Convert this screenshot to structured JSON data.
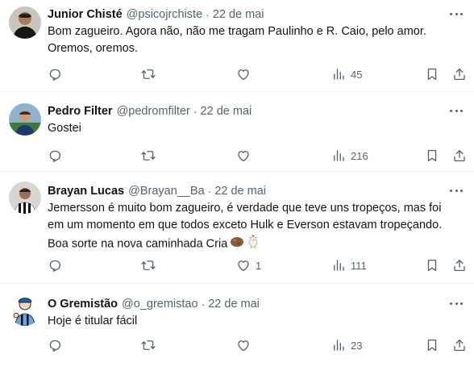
{
  "tweets": [
    {
      "name": "Junior Chisté",
      "handle": "@psicojrchiste",
      "date": "22 de mai",
      "lines": [
        "Bom zagueiro. Agora não, não me tragam Paulinho e R. Caio, pelo amor.",
        "Oremos, oremos."
      ],
      "likes": "",
      "views": "45"
    },
    {
      "name": "Pedro Filter",
      "handle": "@pedromfilter",
      "date": "22 de mai",
      "lines": [
        "Gostei"
      ],
      "likes": "",
      "views": "216"
    },
    {
      "name": "Brayan Lucas",
      "handle": "@Brayan__Ba",
      "date": "22 de mai",
      "lines": [
        "Jemersson é muito bom zagueiro, é verdade que teve uns tropeços, mas foi",
        "em um momento em que todos exceto Hulk e Everson estavam tropeçando.",
        "Boa sorte na nova caminhada Cria"
      ],
      "likes": "1",
      "views": "111"
    },
    {
      "name": "O Gremistão",
      "handle": "@o_gremistao",
      "date": "22 de mai",
      "lines": [
        "Hoje é titular fácil"
      ],
      "likes": "",
      "views": "23"
    }
  ],
  "header_separator": "·",
  "icons": {
    "reply": "reply-icon",
    "retweet": "retweet-icon",
    "like": "heart-icon",
    "views": "views-chart-icon",
    "bookmark": "bookmark-icon",
    "share": "share-icon",
    "more": "more-icon"
  },
  "colors": {
    "text": "#0f1419",
    "muted": "#536471",
    "divider": "#eff3f4"
  }
}
